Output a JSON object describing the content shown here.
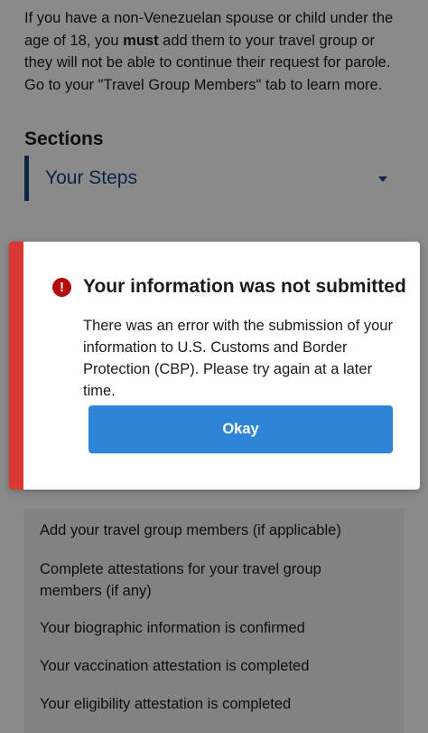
{
  "intro": {
    "text_before": "If you have a non-Venezuelan spouse or child under the age of 18, you ",
    "emphasis": "must",
    "text_after": " add them to your travel group or they will not be able to continue their request for parole. Go to your \"Travel Group Members\" tab to learn more."
  },
  "sections": {
    "title": "Sections",
    "selected": "Your Steps"
  },
  "steps": [
    "Add your travel group members (if applicable)",
    "Complete attestations for your travel group members (if any)",
    "Your biographic information is confirmed",
    "Your vaccination attestation is completed",
    "Your eligibility attestation is completed"
  ],
  "modal": {
    "icon": "exclamation-circle-icon",
    "heading": "Your information was not submitted",
    "body": "There was an error with the submission of your information to U.S. Customs and Border Protection (CBP). Please try again at a later time.",
    "button_label": "Okay"
  },
  "colors": {
    "primary": "#2e85d8",
    "error": "#d83933",
    "navy": "#1a4480"
  }
}
